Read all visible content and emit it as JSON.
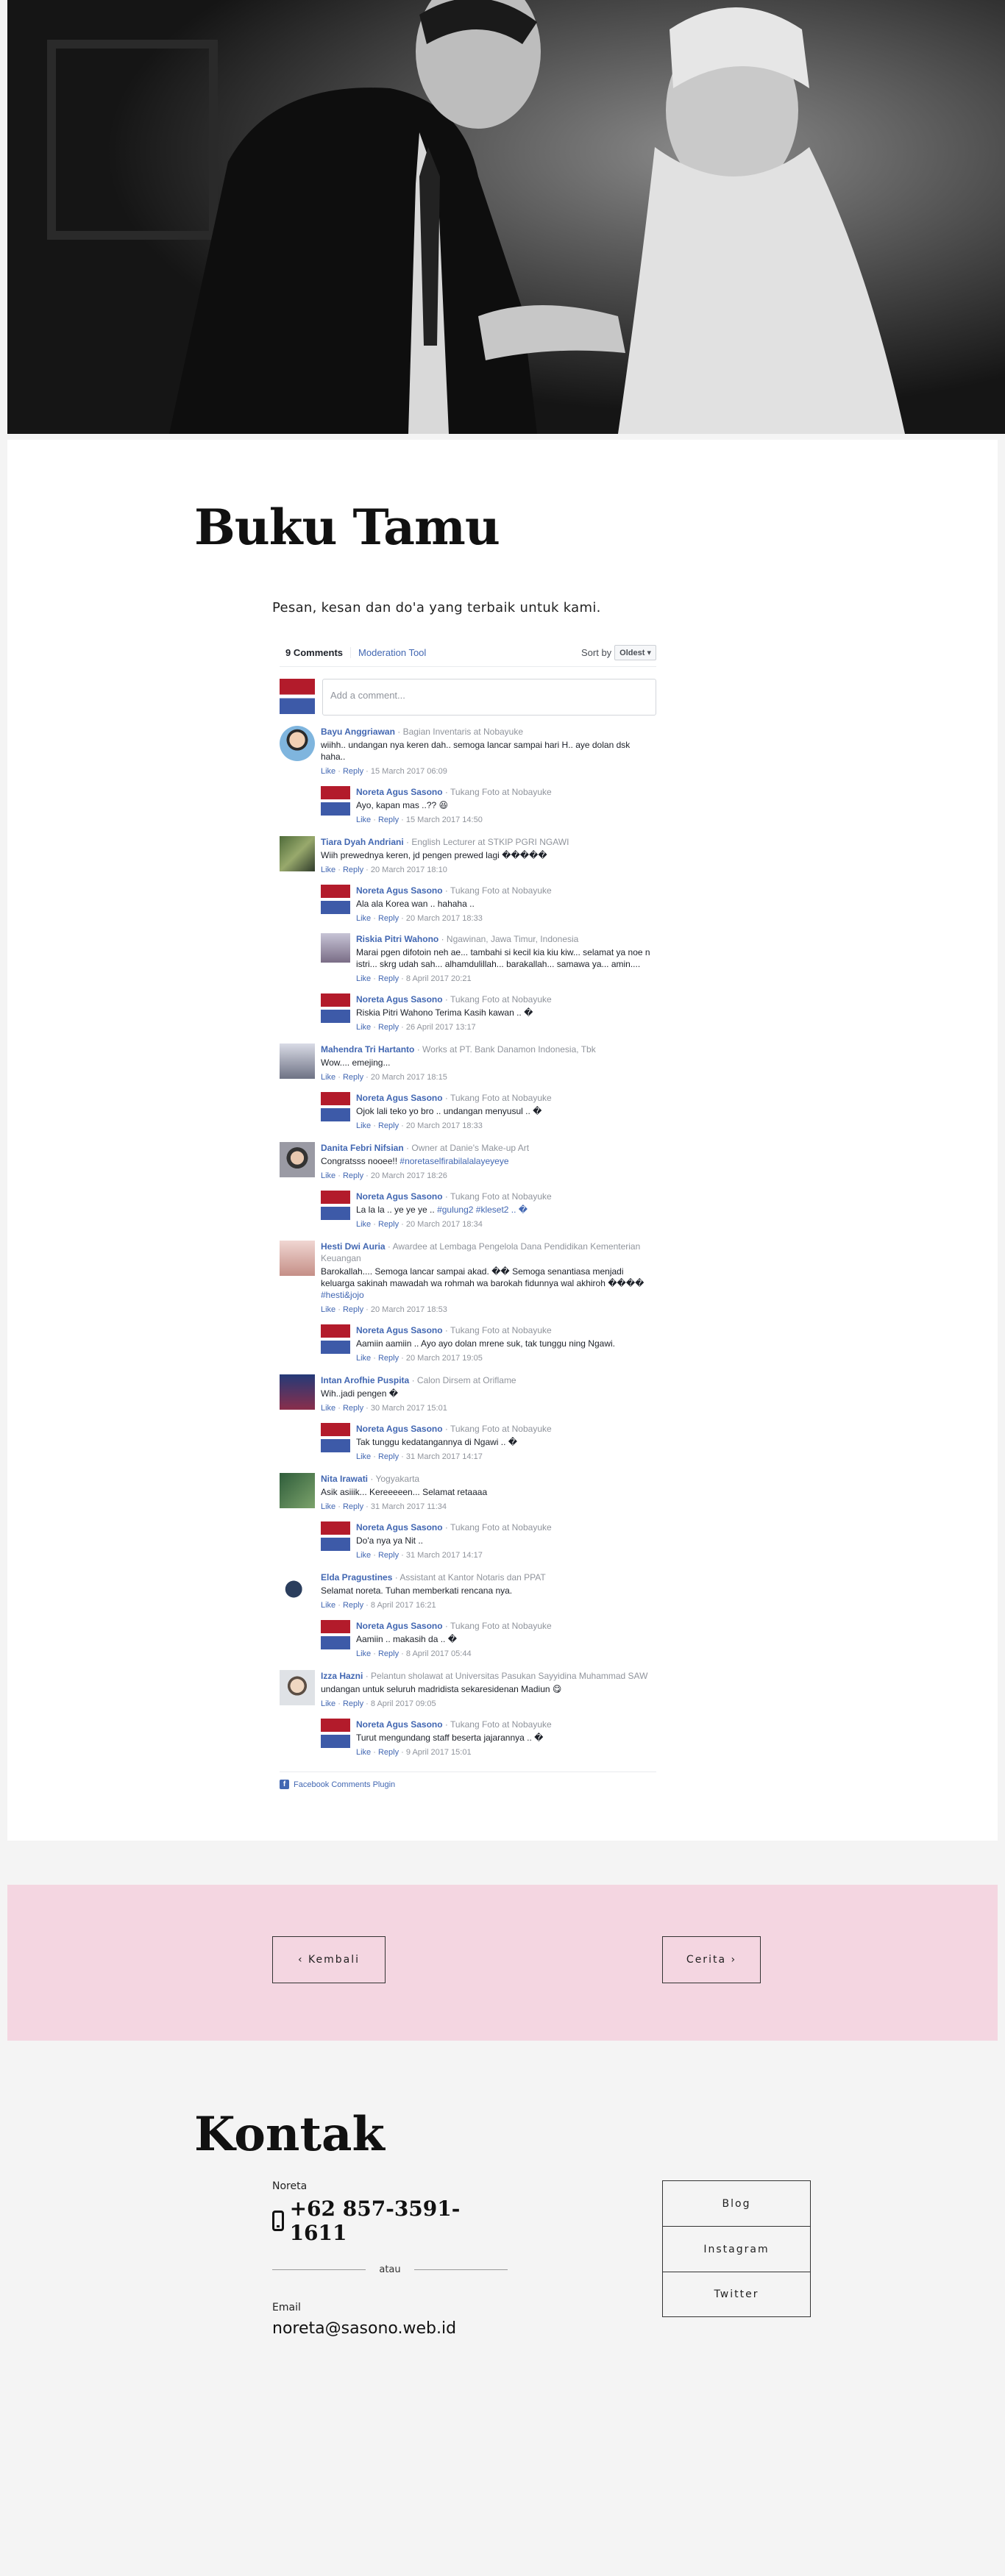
{
  "hero": {
    "alt": "Photo of a couple holding hands"
  },
  "guestbook": {
    "title": "Buku Tamu",
    "intro": "Pesan, kesan dan do'a yang terbaik untuk kami."
  },
  "fb": {
    "count_label": "9 Comments",
    "moderation_label": "Moderation Tool",
    "sort_label": "Sort by",
    "sort_value": "Oldest",
    "add_placeholder": "Add a comment...",
    "like_label": "Like",
    "reply_label": "Reply",
    "footer_label": "Facebook Comments Plugin",
    "comments": [
      {
        "name": "Bayu Anggriawan",
        "meta": "Bagian Inventaris at Nobayuke",
        "text": "wiihh.. undangan nya keren dah.. semoga lancar sampai hari H.. aye dolan dsk haha..",
        "time": "15 March 2017 06:09",
        "avatar": "a1",
        "replies": [
          {
            "name": "Noreta Agus Sasono",
            "meta": "Tukang Foto at Nobayuke",
            "text": "Ayo, kapan mas ..?? 😆",
            "time": "15 March 2017 14:50"
          }
        ]
      },
      {
        "name": "Tiara Dyah Andriani",
        "meta": "English Lecturer at STKIP PGRI NGAWI",
        "text": "Wiih prewednya keren, jd pengen prewed lagi �����",
        "time": "20 March 2017 18:10",
        "avatar": "a2",
        "replies": [
          {
            "name": "Noreta Agus Sasono",
            "meta": "Tukang Foto at Nobayuke",
            "text": "Ala ala Korea wan .. hahaha ..",
            "time": "20 March 2017 18:33"
          },
          {
            "name": "Riskia Pitri Wahono",
            "meta": "Ngawinan, Jawa Timur, Indonesia",
            "text": "Marai pgen difotoin neh ae... tambahi si kecil kia kiu kiw... selamat ya noe n istri... skrg udah sah... alhamdulillah... barakallah... samawa ya... amin....",
            "time": "8 April 2017 20:21",
            "avatar": "a3"
          },
          {
            "name": "Noreta Agus Sasono",
            "meta": "Tukang Foto at Nobayuke",
            "text": "Riskia Pitri Wahono Terima Kasih kawan .. �",
            "time": "26 April 2017 13:17"
          }
        ]
      },
      {
        "name": "Mahendra Tri Hartanto",
        "meta": "Works at PT. Bank Danamon Indonesia, Tbk",
        "text": "Wow.... emejing...",
        "time": "20 March 2017 18:15",
        "avatar": "a4",
        "replies": [
          {
            "name": "Noreta Agus Sasono",
            "meta": "Tukang Foto at Nobayuke",
            "text": "Ojok lali teko yo bro .. undangan menyusul .. �",
            "time": "20 March 2017 18:33"
          }
        ]
      },
      {
        "name": "Danita Febri Nifsian",
        "meta": "Owner at Danie's Make-up Art",
        "text": "Congratsss nooee!! ",
        "hash": "#noretaselfirabilalalayeyeye",
        "time": "20 March 2017 18:26",
        "avatar": "a5",
        "replies": [
          {
            "name": "Noreta Agus Sasono",
            "meta": "Tukang Foto at Nobayuke",
            "text": "La la la .. ye ye ye .. ",
            "hash": "#gulung2 #kleset2 .. �",
            "time": "20 March 2017 18:34"
          }
        ]
      },
      {
        "name": "Hesti Dwi Auria",
        "meta": "Awardee at Lembaga Pengelola Dana Pendidikan Kementerian Keuangan",
        "text": "Barokallah.... Semoga lancar sampai akad. �� Semoga senantiasa menjadi keluarga sakinah mawadah wa rohmah wa barokah fidunnya wal akhiroh ���� ",
        "hash": "#hesti&jojo",
        "time": "20 March 2017 18:53",
        "avatar": "a6",
        "replies": [
          {
            "name": "Noreta Agus Sasono",
            "meta": "Tukang Foto at Nobayuke",
            "text": "Aamiin aamiin .. Ayo ayo dolan mrene suk, tak tunggu ning Ngawi.",
            "time": "20 March 2017 19:05"
          }
        ]
      },
      {
        "name": "Intan Arofhie Puspita",
        "meta": "Calon Dirsem at Oriflame",
        "text": "Wih..jadi pengen �",
        "time": "30 March 2017 15:01",
        "avatar": "a7",
        "replies": [
          {
            "name": "Noreta Agus Sasono",
            "meta": "Tukang Foto at Nobayuke",
            "text": "Tak tunggu kedatangannya di Ngawi .. �",
            "time": "31 March 2017 14:17"
          }
        ]
      },
      {
        "name": "Nita Irawati",
        "meta": "Yogyakarta",
        "text": "Asik asiiik... Kereeeeen... Selamat retaaaa",
        "time": "31 March 2017 11:34",
        "avatar": "a8",
        "replies": [
          {
            "name": "Noreta Agus Sasono",
            "meta": "Tukang Foto at Nobayuke",
            "text": "Do'a nya ya Nit ..",
            "time": "31 March 2017 14:17"
          }
        ]
      },
      {
        "name": "Elda Pragustines",
        "meta": "Assistant at Kantor Notaris dan PPAT",
        "text": "Selamat noreta. Tuhan memberkati rencana nya.",
        "time": "8 April 2017 16:21",
        "avatar": "a9",
        "replies": [
          {
            "name": "Noreta Agus Sasono",
            "meta": "Tukang Foto at Nobayuke",
            "text": "Aamiin .. makasih da .. �",
            "time": "8 April 2017 05:44"
          }
        ]
      },
      {
        "name": "Izza Hazni",
        "meta": "Pelantun sholawat at Universitas Pasukan Sayyidina Muhammad SAW",
        "text": "undangan untuk seluruh madridista sekaresidenan Madiun 😋",
        "time": "8 April 2017 09:05",
        "avatar": "a10",
        "replies": [
          {
            "name": "Noreta Agus Sasono",
            "meta": "Tukang Foto at Nobayuke",
            "text": "Turut mengundang staff beserta jajarannya .. �",
            "time": "9 April 2017 15:01"
          }
        ]
      }
    ]
  },
  "nav": {
    "prev_label": "‹ Kembali",
    "next_label": "Cerita ›"
  },
  "contact": {
    "title": "Kontak",
    "phone_label": "Noreta",
    "phone": "+62 857-3591-1611",
    "or_label": "atau",
    "email_label": "Email",
    "email": "noreta@sasono.web.id",
    "links": [
      "Blog",
      "Instagram",
      "Twitter"
    ]
  }
}
